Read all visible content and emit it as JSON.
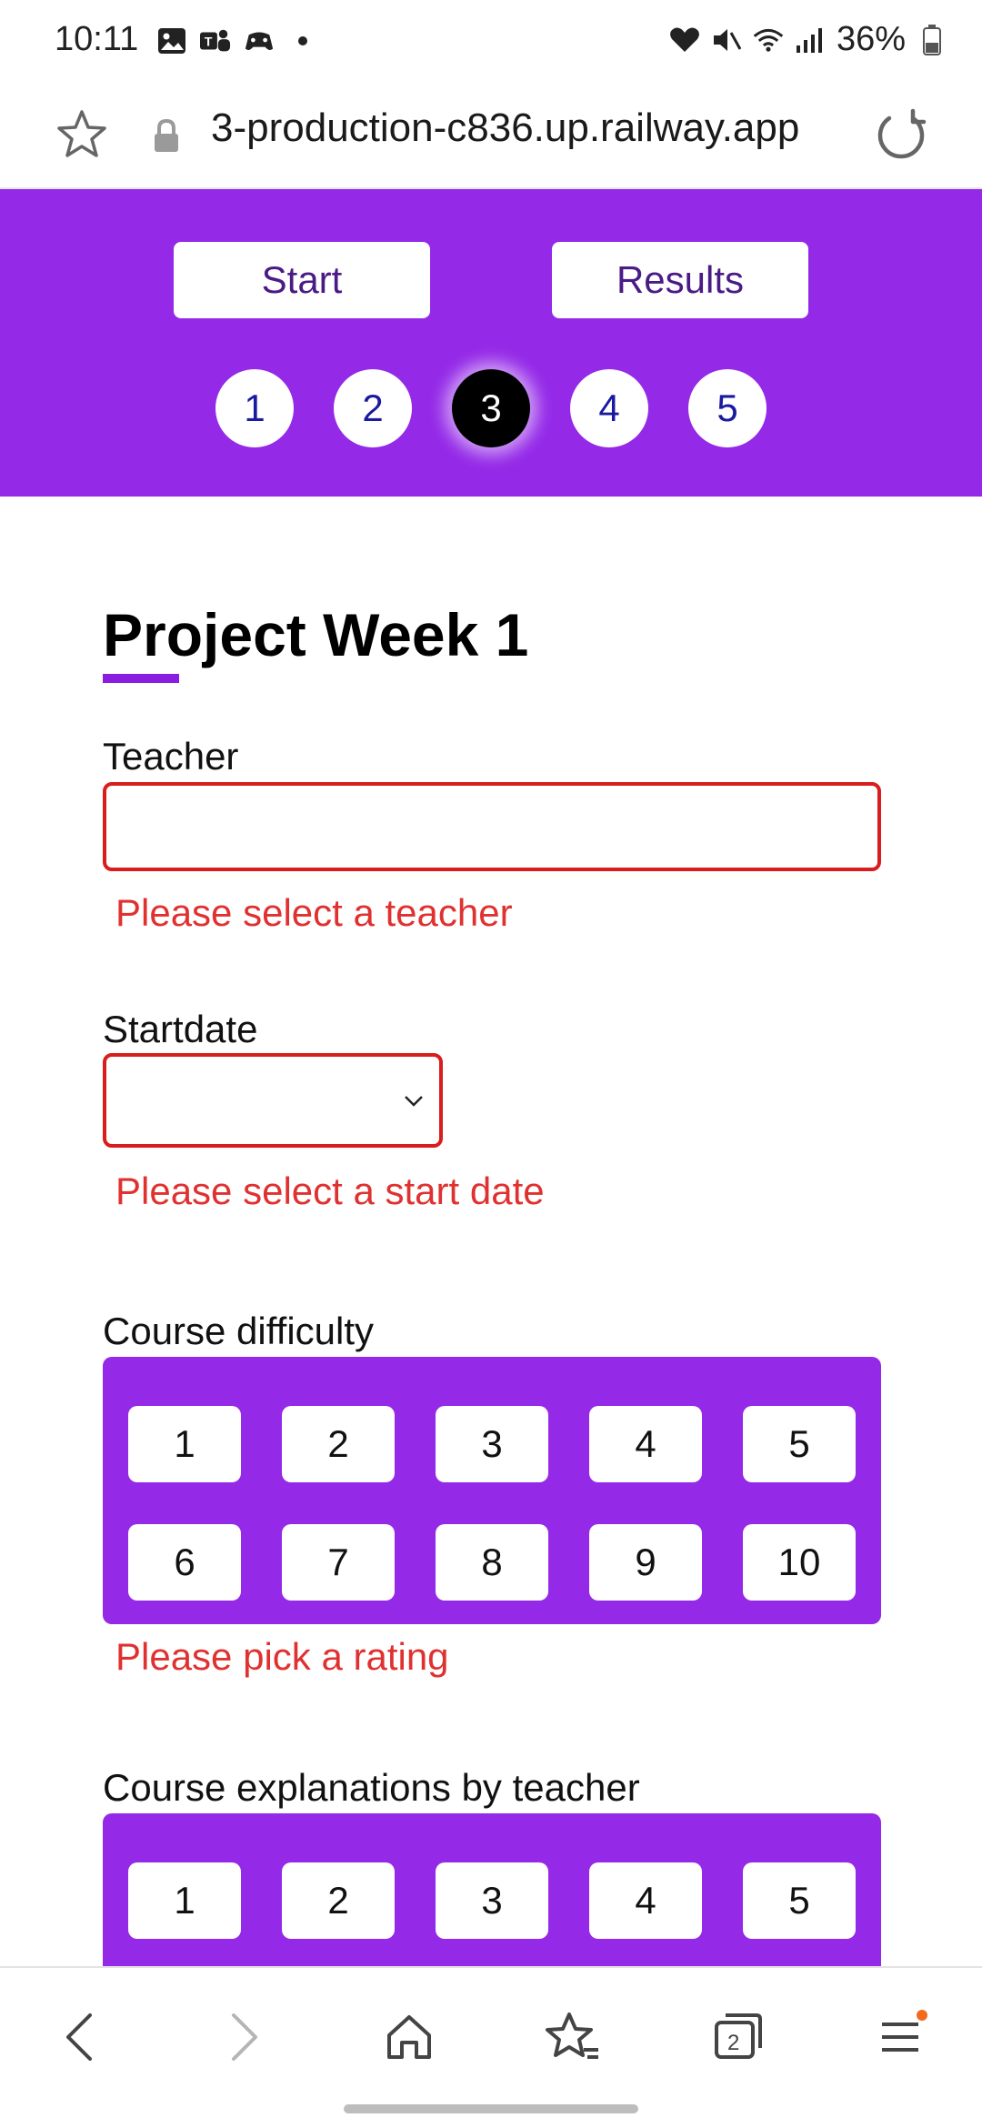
{
  "status_bar": {
    "time": "10:11",
    "battery": "36%",
    "left_icons": [
      "gallery-icon",
      "teams-icon",
      "game-controller-icon",
      "dot-icon"
    ],
    "right_icons": [
      "heart-icon",
      "mute-icon",
      "wifi-icon",
      "signal-icon",
      "battery-icon"
    ]
  },
  "browser": {
    "url": "3-production-c836.up.railway.app"
  },
  "header": {
    "start_label": "Start",
    "results_label": "Results",
    "steps": [
      "1",
      "2",
      "3",
      "4",
      "5"
    ],
    "active_step": "3",
    "background_color": "#9429e8"
  },
  "form": {
    "title": "Project Week 1",
    "teacher_label": "Teacher",
    "teacher_value": "",
    "teacher_error": "Please select a teacher",
    "startdate_label": "Startdate",
    "startdate_value": "",
    "startdate_error": "Please select a start date",
    "difficulty_label": "Course difficulty",
    "difficulty_options": [
      "1",
      "2",
      "3",
      "4",
      "5",
      "6",
      "7",
      "8",
      "9",
      "10"
    ],
    "difficulty_error": "Please pick a rating",
    "explanations_label": "Course explanations by teacher",
    "explanations_options": [
      "1",
      "2",
      "3",
      "4",
      "5"
    ],
    "error_color": "#e03131"
  },
  "bottom_nav": {
    "tab_count": "2",
    "icons": [
      "back-icon",
      "forward-icon",
      "home-icon",
      "bookmarks-icon",
      "tabs-icon",
      "menu-icon"
    ]
  }
}
